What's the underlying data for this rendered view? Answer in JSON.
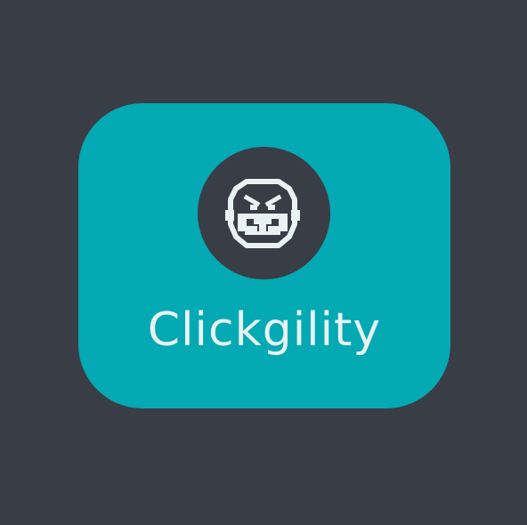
{
  "logo": {
    "brand_name": "Clickgility",
    "icon": "angry-robot-face-icon",
    "colors": {
      "background": "#393d45",
      "card": "#03a9b3",
      "badge": "#393d45",
      "text": "#e8f2f3"
    }
  }
}
